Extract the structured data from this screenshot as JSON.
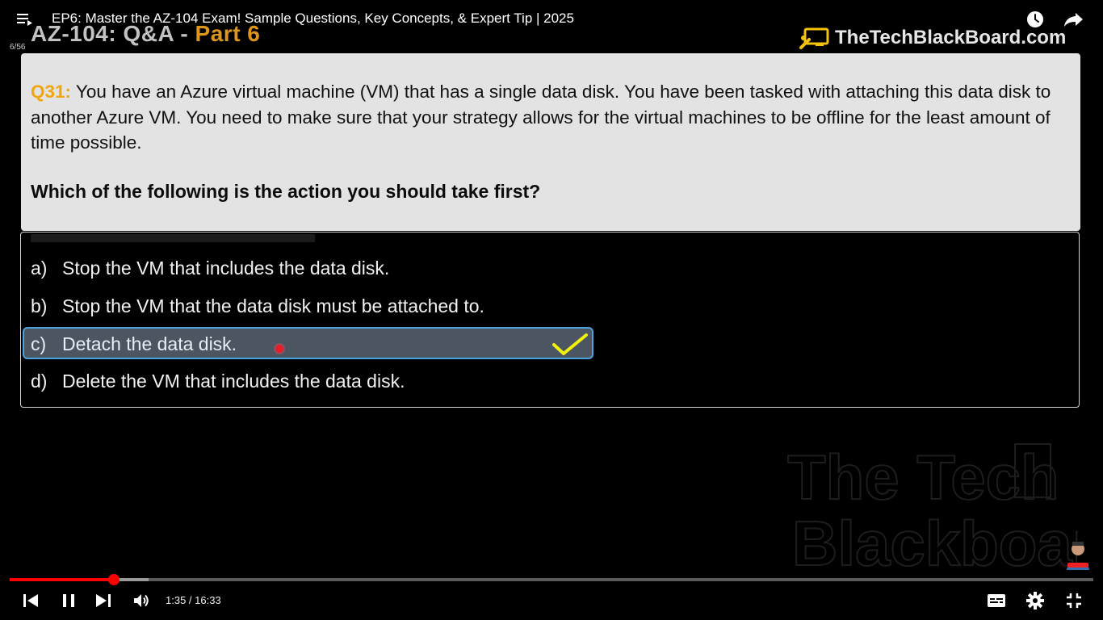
{
  "player": {
    "video_title": "EP6: Master the AZ-104 Exam! Sample Questions, Key Concepts, & Expert Tip | 2025",
    "playlist_index": "6/56",
    "time_display": "1:35 / 16:33",
    "progress_fraction": 0.096,
    "buffered_fraction": 0.128,
    "accent_color": "#ff0000",
    "icons": {
      "menu": "playlist-menu-icon",
      "watch_later": "clock-icon",
      "share": "share-arrow-icon",
      "prev": "skip-previous-icon",
      "pause": "pause-icon",
      "next": "skip-next-icon",
      "volume": "volume-icon",
      "captions": "subtitles-icon",
      "settings": "gear-icon",
      "exit_fullscreen": "exit-fullscreen-icon"
    }
  },
  "slide": {
    "title_main": "AZ-104: Q&A - ",
    "title_part": "Part 6",
    "brand_name": "TheTechBlackBoard.com",
    "question": {
      "number": "Q31:",
      "text": "You have an Azure virtual machine (VM) that has a single data disk. You have been tasked with attaching this data disk to another Azure VM. You need to make sure that your strategy allows for the virtual machines to be offline for the least amount of time possible.",
      "prompt": "Which of the following is the action you should take first?"
    },
    "answers": [
      {
        "letter": "a)",
        "text": "Stop the VM that includes the data disk."
      },
      {
        "letter": "b)",
        "text": "Stop the VM that the data disk must be attached to."
      },
      {
        "letter": "c)",
        "text": "Detach the data disk."
      },
      {
        "letter": "d)",
        "text": "Delete the VM that includes the data disk."
      }
    ],
    "correct_answer": "c)",
    "watermark_text": [
      "The Tech",
      "Blackboard"
    ],
    "colors": {
      "question_number": "#f0a60c",
      "highlight_fill": "#4b5662",
      "highlight_border": "#4aa3df",
      "checkmark": "#f2f20a"
    }
  }
}
